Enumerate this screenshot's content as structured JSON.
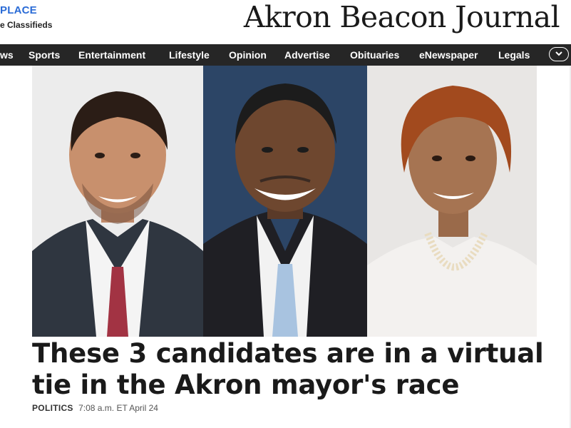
{
  "marketplace": {
    "title": "PLACE",
    "subtitle": "e Classifieds"
  },
  "masthead": {
    "name": "Akron Beacon Journal"
  },
  "nav": {
    "items": [
      {
        "label": "ws"
      },
      {
        "label": "Sports"
      },
      {
        "label": "Entertainment"
      },
      {
        "label": "Lifestyle"
      },
      {
        "label": "Opinion"
      },
      {
        "label": "Advertise"
      },
      {
        "label": "Obituaries"
      },
      {
        "label": "eNewspaper"
      },
      {
        "label": "Legals"
      }
    ],
    "more_icon": "chevron-down-icon"
  },
  "article": {
    "headline": "These 3 candidates are in a virtual tie in the Akron mayor's race",
    "category": "POLITICS",
    "timestamp": "7:08 a.m. ET April 24"
  },
  "colors": {
    "nav_bg": "#262626",
    "brand_blue": "#2a6bd6"
  }
}
